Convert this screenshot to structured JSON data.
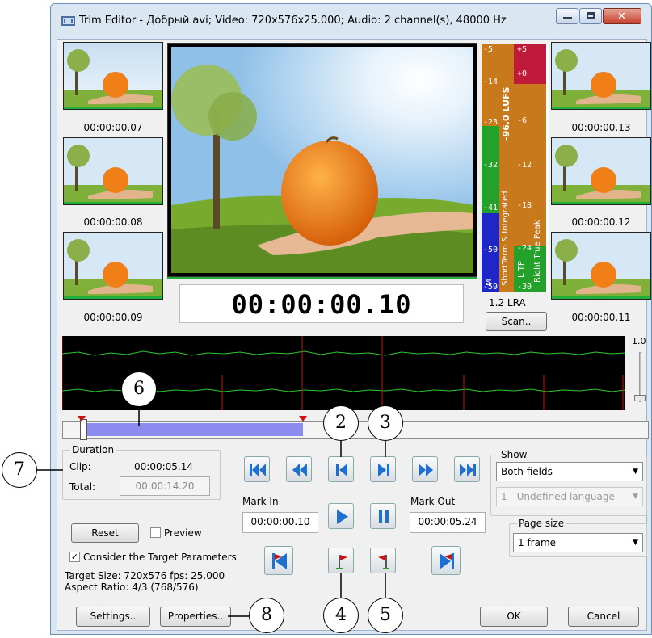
{
  "window": {
    "title": "Trim Editor - Добрый.avi; Video: 720x576x25.000; Audio: 2 channel(s), 48000 Hz",
    "controls": {
      "minimize": "—",
      "maximize": "▢",
      "close": "✕"
    }
  },
  "thumbnails": {
    "left": [
      "00:00:00.07",
      "00:00:00.08",
      "00:00:00.09"
    ],
    "right": [
      "00:00:00.13",
      "00:00:00.12",
      "00:00:00.11"
    ]
  },
  "preview": {
    "timecode": "00:00:00.10"
  },
  "loudness": {
    "lufs": "-96.0 LUFS",
    "left_scale": [
      "-5",
      "-14",
      "-23",
      "-32",
      "-41",
      "-50",
      "-59"
    ],
    "right_scale": [
      "+5",
      "+0",
      "-6",
      "-12",
      "-18",
      "-24",
      "-30"
    ],
    "label_shortterm": "ShortTerm & Integrated",
    "label_m": "M",
    "label_ltp": "L TP",
    "label_rtp": "Right True Peak",
    "lra": "1.2 LRA",
    "scan_label": "Scan.."
  },
  "waveform": {
    "volume_value": "1.0"
  },
  "duration": {
    "group_label": "Duration",
    "clip_label": "Clip:",
    "clip_value": "00:00:05.14",
    "total_label": "Total:",
    "total_value": "00:00:14.20"
  },
  "marks": {
    "mark_in_label": "Mark In",
    "mark_in_value": "00:00:00.10",
    "mark_out_label": "Mark Out",
    "mark_out_value": "00:00:05.24"
  },
  "show": {
    "group_label": "Show",
    "fields_value": "Both fields",
    "language_value": "1 - Undefined language"
  },
  "page_size": {
    "group_label": "Page size",
    "value": "1 frame"
  },
  "options": {
    "reset_label": "Reset",
    "preview_label": "Preview",
    "consider_label": "Consider the Target Parameters",
    "target_size": "Target Size: 720x576 fps: 25.000",
    "aspect_ratio": "Aspect Ratio: 4/3 (768/576)"
  },
  "buttons": {
    "settings": "Settings..",
    "properties": "Properties..",
    "ok": "OK",
    "cancel": "Cancel"
  },
  "callouts": [
    "2",
    "3",
    "4",
    "5",
    "6",
    "7",
    "8"
  ],
  "colors": {
    "accent_blue": "#1f6fd0",
    "range_fill": "#8c8cf0",
    "waveform_green": "#2ec62e",
    "marker_red": "#d01010"
  }
}
